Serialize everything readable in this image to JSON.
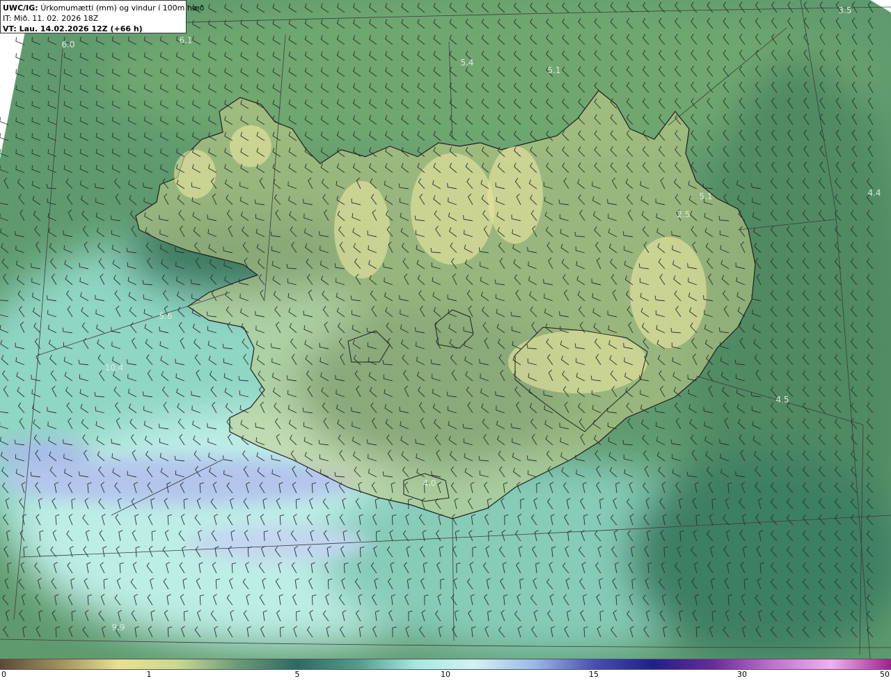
{
  "title": {
    "product": "UWC/IG:",
    "description": "Úrkomumætti (mm) og vindur í 100m hæð",
    "init_time": "IT: Mið. 11. 02. 2026 18Z",
    "valid_time": "VT: Lau. 14.02.2026 12Z (+66 h)"
  },
  "value_labels": [
    {
      "id": "v1",
      "text": "3.5"
    },
    {
      "id": "v2",
      "text": "6.0"
    },
    {
      "id": "v3",
      "text": "6.1"
    },
    {
      "id": "v4",
      "text": "5.4"
    },
    {
      "id": "v5",
      "text": "5.1"
    },
    {
      "id": "v6",
      "text": "4.4"
    },
    {
      "id": "v7",
      "text": "5.1"
    },
    {
      "id": "v8",
      "text": "2.5"
    },
    {
      "id": "v9",
      "text": "5.6"
    },
    {
      "id": "v10",
      "text": "10.4"
    },
    {
      "id": "v11",
      "text": "4.5"
    },
    {
      "id": "v12",
      "text": "4.0"
    },
    {
      "id": "v13",
      "text": "9.9"
    }
  ],
  "colorbar": {
    "ticks": [
      "0",
      "1",
      "5",
      "10",
      "15",
      "30",
      "50"
    ],
    "colors": [
      "#5a4a3a",
      "#a0905a",
      "#e8e095",
      "#c8d890",
      "#6a9a78",
      "#2f6a62",
      "#4f9a8a",
      "#a8e8e0",
      "#d0f2f2",
      "#9ab8e8",
      "#4850b0",
      "#20208a",
      "#6a2a9a",
      "#c070d0",
      "#f0b0f0",
      "#a02090"
    ]
  }
}
